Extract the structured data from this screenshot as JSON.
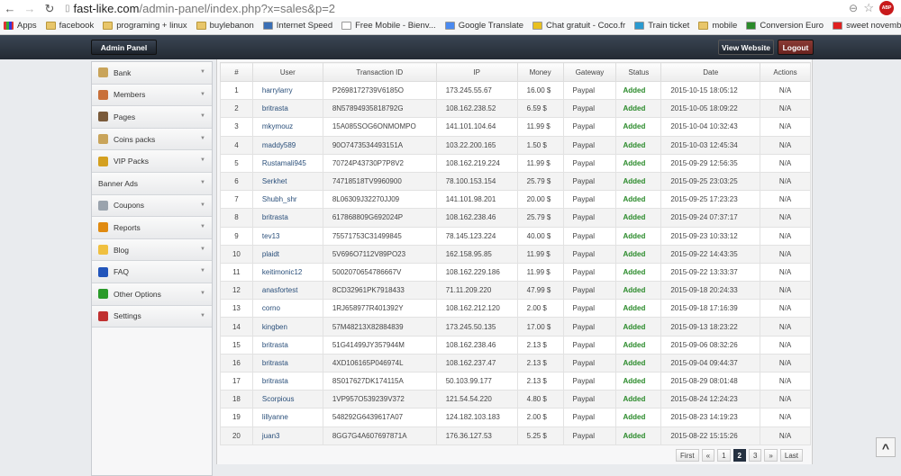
{
  "browser": {
    "url_host": "fast-like.com",
    "url_path": "/admin-panel/index.php?x=sales&p=2",
    "abp": "ABP",
    "bookmarks": [
      "Apps",
      "facebook",
      "programing + linux",
      "buylebanon",
      "Internet Speed",
      "Free Mobile - Bienv...",
      "Google Translate",
      "Chat gratuit - Coco.fr",
      "Train ticket",
      "mobile",
      "Conversion Euro",
      "sweet november ... w..."
    ]
  },
  "header": {
    "title": "Admin Panel",
    "view_website": "View Website",
    "logout": "Logout"
  },
  "sidebar": {
    "items": [
      {
        "label": "Bank",
        "color": "#c9a45a"
      },
      {
        "label": "Members",
        "color": "#c9703a"
      },
      {
        "label": "Pages",
        "color": "#7a5a3a"
      },
      {
        "label": "Coins packs",
        "color": "#c9a45a"
      },
      {
        "label": "VIP Packs",
        "color": "#d4a020"
      },
      {
        "label": "Banner Ads",
        "color": ""
      },
      {
        "label": "Coupons",
        "color": "#9aa3ad"
      },
      {
        "label": "Reports",
        "color": "#e08a10"
      },
      {
        "label": "Blog",
        "color": "#f0c040"
      },
      {
        "label": "FAQ",
        "color": "#2255bb"
      },
      {
        "label": "Other Options",
        "color": "#2a9a2a"
      },
      {
        "label": "Settings",
        "color": "#c03030"
      }
    ]
  },
  "table": {
    "columns": [
      "#",
      "User",
      "Transaction ID",
      "IP",
      "Money",
      "Gateway",
      "Status",
      "Date",
      "Actions"
    ],
    "rows": [
      [
        "1",
        "harrylarry",
        "P2698172739V6185O",
        "173.245.55.67",
        "16.00 $",
        "Paypal",
        "Added",
        "2015-10-15 18:05:12",
        "N/A"
      ],
      [
        "2",
        "britrasta",
        "8N57894935818792G",
        "108.162.238.52",
        "6.59 $",
        "Paypal",
        "Added",
        "2015-10-05 18:09:22",
        "N/A"
      ],
      [
        "3",
        "mkymouz",
        "15A085SOG6ONMOMPO",
        "141.101.104.64",
        "11.99 $",
        "Paypal",
        "Added",
        "2015-10-04 10:32:43",
        "N/A"
      ],
      [
        "4",
        "maddy589",
        "90O7473534493151A",
        "103.22.200.165",
        "1.50 $",
        "Paypal",
        "Added",
        "2015-10-03 12:45:34",
        "N/A"
      ],
      [
        "5",
        "Rustamali945",
        "70724P43730P7P8V2",
        "108.162.219.224",
        "11.99 $",
        "Paypal",
        "Added",
        "2015-09-29 12:56:35",
        "N/A"
      ],
      [
        "6",
        "Serkhet",
        "74718518TV9960900",
        "78.100.153.154",
        "25.79 $",
        "Paypal",
        "Added",
        "2015-09-25 23:03:25",
        "N/A"
      ],
      [
        "7",
        "Shubh_shr",
        "8L06309J32270JJ09",
        "141.101.98.201",
        "20.00 $",
        "Paypal",
        "Added",
        "2015-09-25 17:23:23",
        "N/A"
      ],
      [
        "8",
        "britrasta",
        "617868809G692024P",
        "108.162.238.46",
        "25.79 $",
        "Paypal",
        "Added",
        "2015-09-24 07:37:17",
        "N/A"
      ],
      [
        "9",
        "tev13",
        "75571753C31499845",
        "78.145.123.224",
        "40.00 $",
        "Paypal",
        "Added",
        "2015-09-23 10:33:12",
        "N/A"
      ],
      [
        "10",
        "plaidt",
        "5V696O7112V89PO23",
        "162.158.95.85",
        "11.99 $",
        "Paypal",
        "Added",
        "2015-09-22 14:43:35",
        "N/A"
      ],
      [
        "11",
        "keitimonic12",
        "5002070654786667V",
        "108.162.229.186",
        "11.99 $",
        "Paypal",
        "Added",
        "2015-09-22 13:33:37",
        "N/A"
      ],
      [
        "12",
        "anasfortest",
        "8CD32961PK7918433",
        "71.11.209.220",
        "47.99 $",
        "Paypal",
        "Added",
        "2015-09-18 20:24:33",
        "N/A"
      ],
      [
        "13",
        "corno",
        "1RJ658977R401392Y",
        "108.162.212.120",
        "2.00 $",
        "Paypal",
        "Added",
        "2015-09-18 17:16:39",
        "N/A"
      ],
      [
        "14",
        "kingben",
        "57M48213X82884839",
        "173.245.50.135",
        "17.00 $",
        "Paypal",
        "Added",
        "2015-09-13 18:23:22",
        "N/A"
      ],
      [
        "15",
        "britrasta",
        "51G41499JY357944M",
        "108.162.238.46",
        "2.13 $",
        "Paypal",
        "Added",
        "2015-09-06 08:32:26",
        "N/A"
      ],
      [
        "16",
        "britrasta",
        "4XD106165P046974L",
        "108.162.237.47",
        "2.13 $",
        "Paypal",
        "Added",
        "2015-09-04 09:44:37",
        "N/A"
      ],
      [
        "17",
        "britrasta",
        "8S017627DK174115A",
        "50.103.99.177",
        "2.13 $",
        "Paypal",
        "Added",
        "2015-08-29 08:01:48",
        "N/A"
      ],
      [
        "18",
        "Scorpious",
        "1VP957O539239V372",
        "121.54.54.220",
        "4.80 $",
        "Paypal",
        "Added",
        "2015-08-24 12:24:23",
        "N/A"
      ],
      [
        "19",
        "lillyanne",
        "548292G6439617A07",
        "124.182.103.183",
        "2.00 $",
        "Paypal",
        "Added",
        "2015-08-23 14:19:23",
        "N/A"
      ],
      [
        "20",
        "juan3",
        "8GG7G4A607697871A",
        "176.36.127.53",
        "5.25 $",
        "Paypal",
        "Added",
        "2015-08-22 15:15:26",
        "N/A"
      ]
    ]
  },
  "pagination": {
    "items": [
      "First",
      "«",
      "1",
      "2",
      "3",
      "»",
      "Last"
    ],
    "current": "2"
  },
  "scroll_top": "^"
}
